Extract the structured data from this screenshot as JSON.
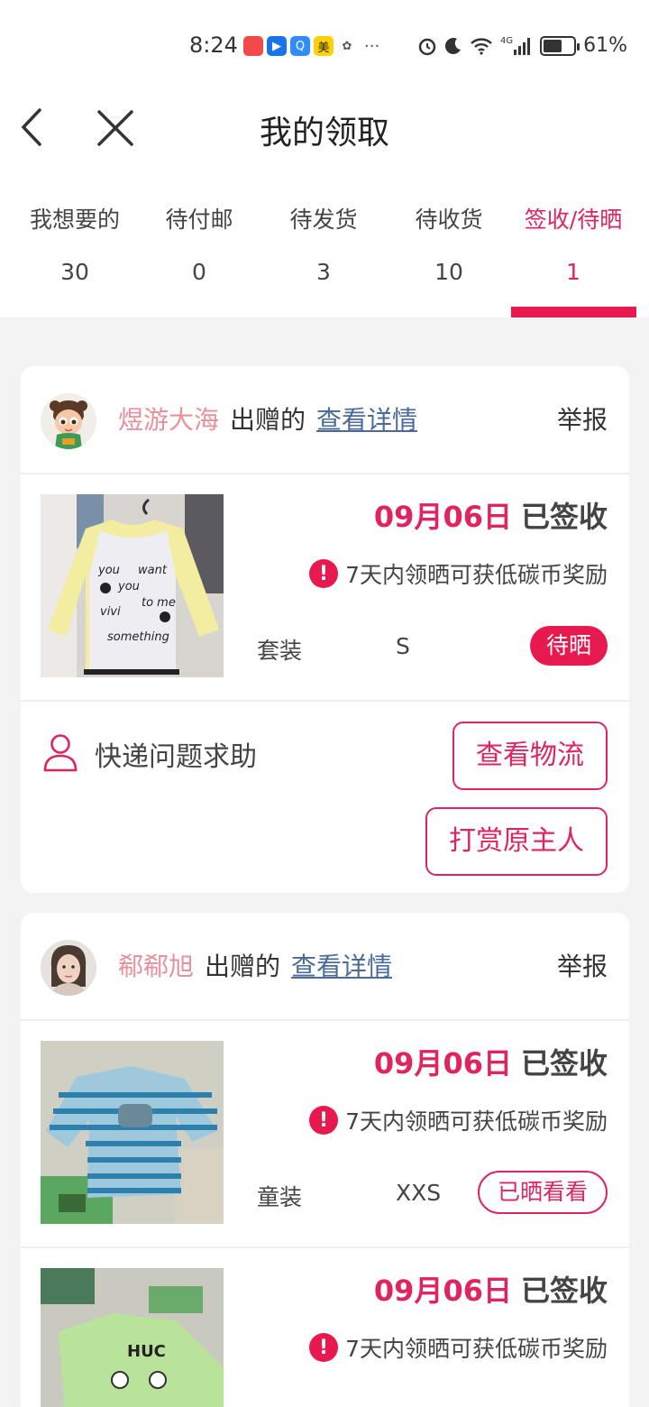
{
  "status_bar": {
    "time": "8:24",
    "apps": [
      {
        "icon": "app-red-icon",
        "color": "#f24a4a",
        "glyph": ""
      },
      {
        "icon": "app-flag-icon",
        "color": "#1a74e8",
        "glyph": "▶"
      },
      {
        "icon": "app-search-icon",
        "color": "#2f8df5",
        "glyph": "Q"
      },
      {
        "icon": "meituan-icon",
        "color": "#ffd100",
        "glyph": "美"
      },
      {
        "icon": "wechat-icon",
        "color": "#555555",
        "glyph": "✿"
      }
    ],
    "more": "···",
    "signal": "4G",
    "battery_level": 61,
    "battery": "61%"
  },
  "nav": {
    "title": "我的领取",
    "back_icon": "chevron-left-icon",
    "close_icon": "close-icon"
  },
  "tabs": [
    {
      "label": "我想要的",
      "count": "30"
    },
    {
      "label": "待付邮",
      "count": "0"
    },
    {
      "label": "待发货",
      "count": "3"
    },
    {
      "label": "待收货",
      "count": "10"
    },
    {
      "label": "签收/待晒",
      "count": "1"
    }
  ],
  "colors": {
    "accent": "#e8194f",
    "name": "#e8919c",
    "link": "#4a6a9a"
  },
  "cards": [
    {
      "giver": "煜游大海",
      "verb": "出赠的",
      "detail_link": "查看详情",
      "report": "举报",
      "items": [
        {
          "date": "09月06日",
          "status": "已签收",
          "tip": "7天内领晒可获低碳币奖励",
          "category": "套装",
          "size": "S",
          "badge": "待晒",
          "print": [
            "you",
            "want",
            "you",
            "to me",
            "vivi",
            "something"
          ]
        }
      ],
      "help": "快递问题求助",
      "buttons": [
        "查看物流",
        "打赏原主人"
      ]
    },
    {
      "giver": "郗郗旭",
      "verb": "出赠的",
      "detail_link": "查看详情",
      "report": "举报",
      "items": [
        {
          "date": "09月06日",
          "status": "已签收",
          "tip": "7天内领晒可获低碳币奖励",
          "category": "童装",
          "size": "XXS",
          "badge": "已晒看看"
        },
        {
          "date": "09月06日",
          "status": "已签收",
          "tip": "7天内领晒可获低碳币奖励",
          "print": "HUC"
        }
      ]
    }
  ]
}
